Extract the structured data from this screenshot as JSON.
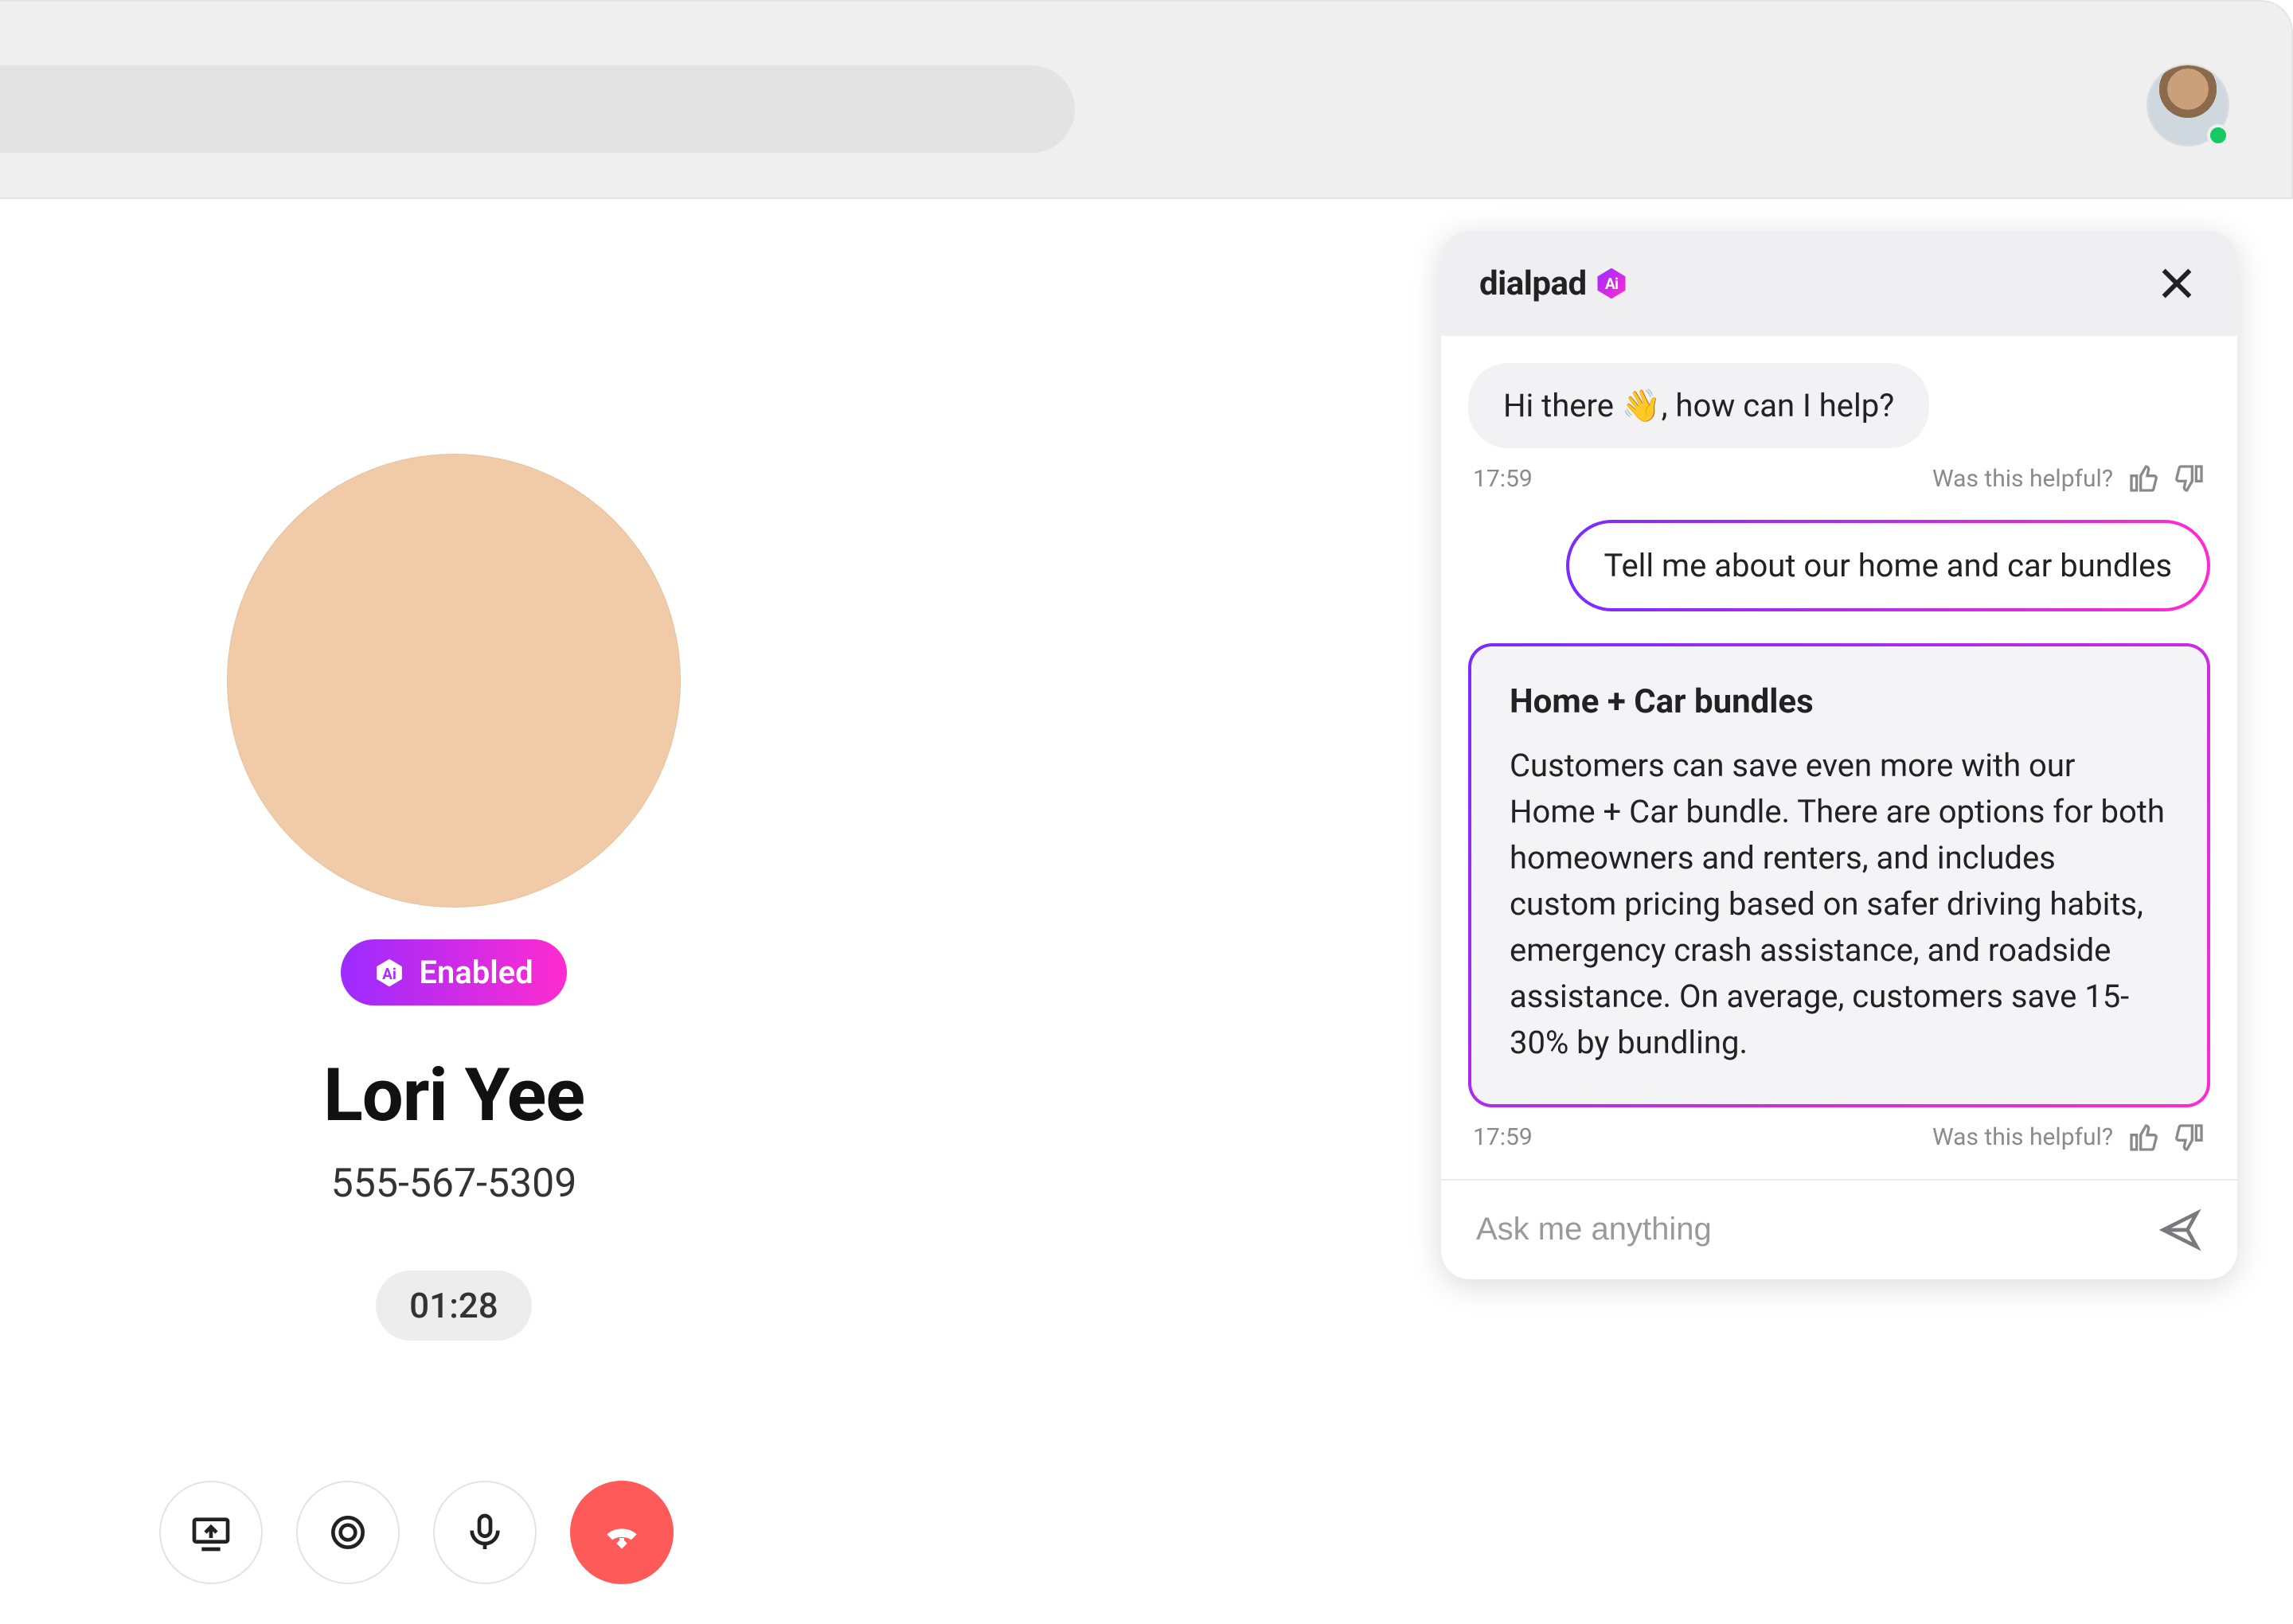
{
  "ai_badge": {
    "label": "Enabled"
  },
  "caller": {
    "name": "Lori Yee",
    "phone": "555-567-5309",
    "duration": "01:28"
  },
  "assistant": {
    "brand": "dialpad",
    "greeting": "Hi there 👋,  how can I help?",
    "timestamp1": "17:59",
    "timestamp2": "17:59",
    "helpful_label": "Was this helpful?",
    "user_message": "Tell me about our home and car bundles",
    "answer_title": "Home + Car bundles",
    "answer_body": "Customers can save even more with our Home + Car bundle. There are options for both homeowners and renters, and includes custom pricing based on safer driving habits, emergency crash assistance, and roadside assistance. On average, customers save 15-30% by bundling.",
    "input_placeholder": "Ask me anything"
  }
}
